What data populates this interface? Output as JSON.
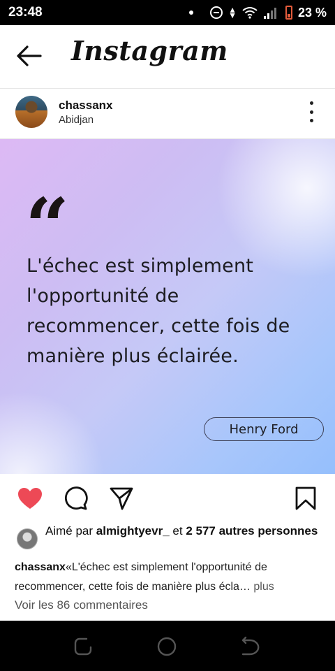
{
  "status_bar": {
    "time": "23:48",
    "battery_percent": "23 %",
    "battery_level": 0.23,
    "icons": [
      "notification-dot-icon",
      "dnd-icon",
      "data-arrows-icon",
      "wifi-icon",
      "signal-icon",
      "battery-icon"
    ]
  },
  "header": {
    "title": "Instagram",
    "back_icon": "arrow-left-icon"
  },
  "post": {
    "username": "chassanx",
    "location": "Abidjan",
    "quote_mark": "“",
    "quote_text": "L'échec est simplement l'opportunité de recommencer, cette fois de manière plus éclairée.",
    "author": "Henry Ford",
    "colors": {
      "like": "#ed4956",
      "gradient_start": "#ddb9f4",
      "gradient_end": "#95bffc"
    }
  },
  "actions": {
    "liked": true,
    "icons": [
      "heart-icon",
      "comment-icon",
      "share-icon",
      "bookmark-icon"
    ]
  },
  "likes": {
    "prefix": "Aimé par",
    "user": "almightyevr_",
    "joiner": "et",
    "count": "2 577 autres personnes"
  },
  "caption": {
    "username": "chassanx",
    "text": "«L'échec est simplement l'opportunité de recommencer, cette fois de manière plus écla…",
    "more": "plus"
  },
  "comments_link": "Voir les 86 commentaires",
  "nav": {
    "icons": [
      "nav-back-icon",
      "nav-home-icon",
      "nav-recents-icon"
    ]
  }
}
